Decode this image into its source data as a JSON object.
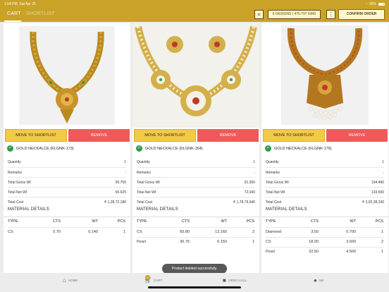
{
  "status_bar": {
    "time": "1:54 PM",
    "date": "Sat Apr 25",
    "wifi": "wifi-icon",
    "battery": "96%"
  },
  "header": {
    "tabs": [
      {
        "label": "CART",
        "active": true
      },
      {
        "label": "SHORTLIST",
        "active": false
      }
    ],
    "summary": "6 DESIGNS | 470.797 GMS",
    "confirm_label": "CONFIRM ORDER",
    "accent_color": "#c9a227"
  },
  "cards": [
    {
      "shortlist_label": "MOVE TO SHORTLIST",
      "remove_label": "REMOVE",
      "name": "GOLD NECKALCE (KLGNK-173)",
      "info": [
        {
          "label": "Quantity",
          "value": "1"
        },
        {
          "label": "Remarks",
          "value": "-"
        },
        {
          "label": "Total Gross Wt",
          "value": "65.765"
        },
        {
          "label": "Total Net Wt",
          "value": "65.625"
        },
        {
          "label": "Total Cost",
          "value": "₹ 1,28,72,180"
        }
      ],
      "material_title": "MATERIAL DETAILS",
      "material_headers": [
        "TYPE",
        "CTS",
        "WT",
        "PCS"
      ],
      "materials": [
        [
          "CS",
          "0.70",
          "0.140",
          "1"
        ]
      ]
    },
    {
      "shortlist_label": "MOVE TO SHORTLIST",
      "remove_label": "REMOVE",
      "name": "GOLD NECKALCE (KLGNK-164)",
      "info": [
        {
          "label": "Quantity",
          "value": "1"
        },
        {
          "label": "Remarks",
          "value": "-"
        },
        {
          "label": "Total Gross Wt",
          "value": "91.350"
        },
        {
          "label": "Total Net Wt",
          "value": "72.040"
        },
        {
          "label": "Total Cost",
          "value": "₹ 1,78,79,940"
        }
      ],
      "material_title": "MATERIAL DETAILS",
      "material_headers": [
        "TYPE",
        "CTS",
        "WT",
        "PCS"
      ],
      "materials": [
        [
          "CS",
          "65.80",
          "13.160",
          "3"
        ],
        [
          "Pearl",
          "30.75",
          "6.150",
          "1"
        ]
      ]
    },
    {
      "shortlist_label": "MOVE TO SHORTLIST",
      "remove_label": "REMOVE",
      "name": "GOLD NECKALCE (KLGNK-176)",
      "info": [
        {
          "label": "Quantity",
          "value": "1"
        },
        {
          "label": "Remarks",
          "value": "-"
        },
        {
          "label": "Total Gross Wt",
          "value": "154.490"
        },
        {
          "label": "Total Net Wt",
          "value": "133.590"
        },
        {
          "label": "Total Cost",
          "value": "₹ 3,02,38,330"
        }
      ],
      "material_title": "MATERIAL DETAILS",
      "material_headers": [
        "TYPE",
        "CTS",
        "WT",
        "PCS"
      ],
      "materials": [
        [
          "Diamond",
          "3.50",
          "0.700",
          "1"
        ],
        [
          "CS",
          "18.00",
          "3.600",
          "2"
        ],
        [
          "Pearl",
          "22.50",
          "4.500",
          "1"
        ]
      ]
    }
  ],
  "bottom_nav": [
    {
      "label": "HOME",
      "icon": "home-icon"
    },
    {
      "label": "CART",
      "icon": "cart-icon",
      "badge": "6"
    },
    {
      "label": "VIDEO CALL",
      "icon": "video-icon"
    },
    {
      "label": "ME",
      "icon": "user-icon"
    }
  ],
  "toast": "Product deleted successfully."
}
